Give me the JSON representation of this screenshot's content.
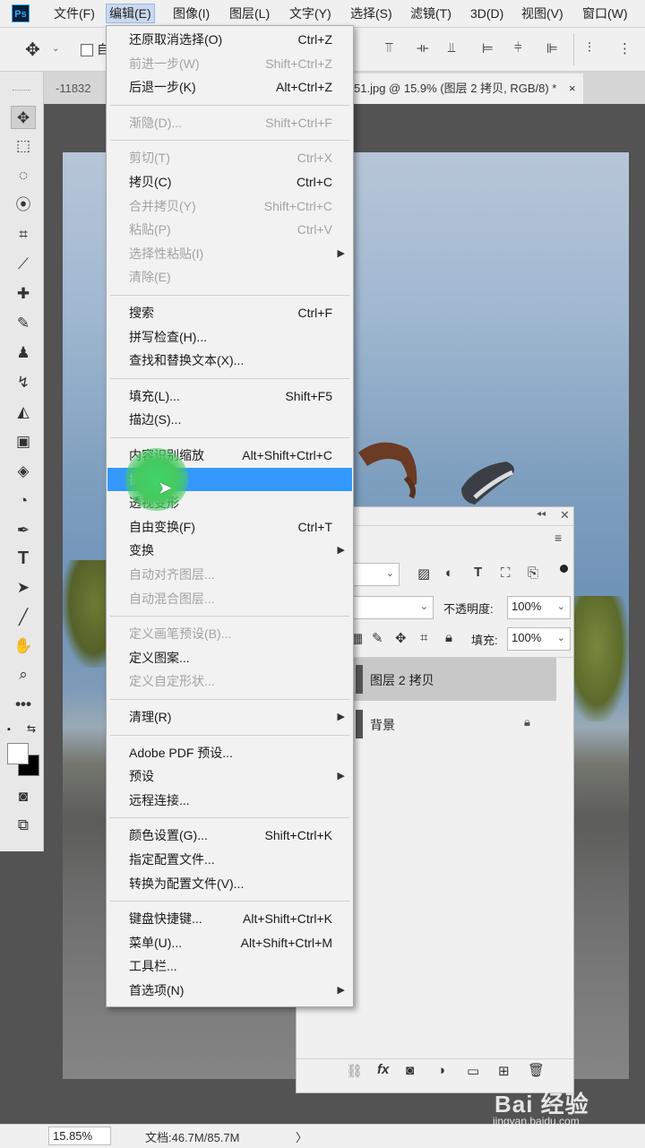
{
  "app": {
    "logo": "Ps"
  },
  "menubar": {
    "items": [
      "文件(F)",
      "编辑(E)",
      "图像(I)",
      "图层(L)",
      "文字(Y)",
      "选择(S)",
      "滤镜(T)",
      "3D(D)",
      "视图(V)",
      "窗口(W)"
    ],
    "active_index": 1
  },
  "options_bar": {
    "auto_select_label": "自"
  },
  "tabs": {
    "left_tab": "-11832",
    "active_tab": "51.jpg @ 15.9% (图层 2 拷贝, RGB/8) *",
    "close_glyph": "×"
  },
  "edit_menu": {
    "groups": [
      [
        {
          "label": "还原取消选择(O)",
          "shortcut": "Ctrl+Z",
          "enabled": true
        },
        {
          "label": "前进一步(W)",
          "shortcut": "Shift+Ctrl+Z",
          "enabled": false
        },
        {
          "label": "后退一步(K)",
          "shortcut": "Alt+Ctrl+Z",
          "enabled": true
        }
      ],
      [
        {
          "label": "渐隐(D)...",
          "shortcut": "Shift+Ctrl+F",
          "enabled": false
        }
      ],
      [
        {
          "label": "剪切(T)",
          "shortcut": "Ctrl+X",
          "enabled": false
        },
        {
          "label": "拷贝(C)",
          "shortcut": "Ctrl+C",
          "enabled": true
        },
        {
          "label": "合并拷贝(Y)",
          "shortcut": "Shift+Ctrl+C",
          "enabled": false
        },
        {
          "label": "粘贴(P)",
          "shortcut": "Ctrl+V",
          "enabled": false
        },
        {
          "label": "选择性粘贴(I)",
          "shortcut": "",
          "enabled": false,
          "submenu": true
        },
        {
          "label": "清除(E)",
          "shortcut": "",
          "enabled": false
        }
      ],
      [
        {
          "label": "搜索",
          "shortcut": "Ctrl+F",
          "enabled": true
        },
        {
          "label": "拼写检查(H)...",
          "shortcut": "",
          "enabled": true
        },
        {
          "label": "查找和替换文本(X)...",
          "shortcut": "",
          "enabled": true
        }
      ],
      [
        {
          "label": "填充(L)...",
          "shortcut": "Shift+F5",
          "enabled": true
        },
        {
          "label": "描边(S)...",
          "shortcut": "",
          "enabled": true
        }
      ],
      [
        {
          "label": "内容识别缩放",
          "shortcut": "Alt+Shift+Ctrl+C",
          "enabled": true
        },
        {
          "label": "操控变形",
          "shortcut": "",
          "enabled": true,
          "highlighted": true
        },
        {
          "label": "透视变形",
          "shortcut": "",
          "enabled": true
        },
        {
          "label": "自由变换(F)",
          "shortcut": "Ctrl+T",
          "enabled": true
        },
        {
          "label": "变换",
          "shortcut": "",
          "enabled": true,
          "submenu": true
        },
        {
          "label": "自动对齐图层...",
          "shortcut": "",
          "enabled": false
        },
        {
          "label": "自动混合图层...",
          "shortcut": "",
          "enabled": false
        }
      ],
      [
        {
          "label": "定义画笔预设(B)...",
          "shortcut": "",
          "enabled": false
        },
        {
          "label": "定义图案...",
          "shortcut": "",
          "enabled": true
        },
        {
          "label": "定义自定形状...",
          "shortcut": "",
          "enabled": false
        }
      ],
      [
        {
          "label": "清理(R)",
          "shortcut": "",
          "enabled": true,
          "submenu": true
        }
      ],
      [
        {
          "label": "Adobe PDF 预设...",
          "shortcut": "",
          "enabled": true
        },
        {
          "label": "预设",
          "shortcut": "",
          "enabled": true,
          "submenu": true
        },
        {
          "label": "远程连接...",
          "shortcut": "",
          "enabled": true
        }
      ],
      [
        {
          "label": "颜色设置(G)...",
          "shortcut": "Shift+Ctrl+K",
          "enabled": true
        },
        {
          "label": "指定配置文件...",
          "shortcut": "",
          "enabled": true
        },
        {
          "label": "转换为配置文件(V)...",
          "shortcut": "",
          "enabled": true
        }
      ],
      [
        {
          "label": "键盘快捷键...",
          "shortcut": "Alt+Shift+Ctrl+K",
          "enabled": true
        },
        {
          "label": "菜单(U)...",
          "shortcut": "Alt+Shift+Ctrl+M",
          "enabled": true
        },
        {
          "label": "工具栏...",
          "shortcut": "",
          "enabled": true
        },
        {
          "label": "首选项(N)",
          "shortcut": "",
          "enabled": true,
          "submenu": true
        }
      ]
    ]
  },
  "layers_panel": {
    "opacity_label": "不透明度:",
    "opacity_value": "100%",
    "fill_label": "填充:",
    "fill_value": "100%",
    "layers": [
      {
        "name": "图层 2 拷贝",
        "selected": true,
        "locked": false
      },
      {
        "name": "背景",
        "selected": false,
        "locked": true
      }
    ]
  },
  "statusbar": {
    "zoom": "15.85%",
    "doc_info": "文档:46.7M/85.7M",
    "arrow": "〉"
  },
  "watermark": {
    "brand": "Bai 经验",
    "url": "jingyan.baidu.com"
  },
  "colors": {
    "highlight": "#3399ff",
    "menu_bg": "#f2f2f2",
    "cursor": "#46c95f"
  }
}
